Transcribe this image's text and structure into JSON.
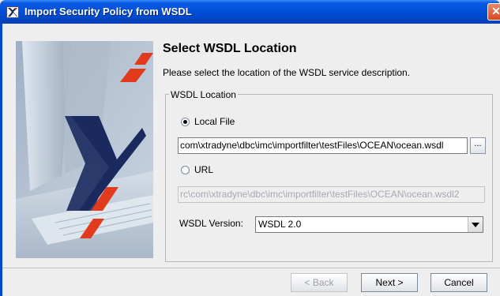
{
  "window": {
    "title": "Import Security Policy from WSDL",
    "close_glyph": "✕"
  },
  "header": {
    "title": "Select WSDL Location",
    "description": "Please select the location of the WSDL service description."
  },
  "group": {
    "legend": "WSDL Location",
    "local_file": {
      "label": "Local File",
      "selected": true,
      "value": "com\\xtradyne\\dbc\\imc\\importfilter\\testFiles\\OCEAN\\ocean.wsdl",
      "browse_label": "..."
    },
    "url": {
      "label": "URL",
      "selected": false,
      "value": "rc\\com\\xtradyne\\dbc\\imc\\importfilter\\testFiles\\OCEAN\\ocean.wsdl2"
    },
    "version": {
      "label": "WSDL Version:",
      "selected": "WSDL 2.0"
    }
  },
  "buttons": {
    "back": "< Back",
    "next": "Next >",
    "cancel": "Cancel"
  },
  "colors": {
    "accent": "#0046d5",
    "logo_red": "#e23a1c",
    "logo_navy": "#1b2a5e"
  }
}
